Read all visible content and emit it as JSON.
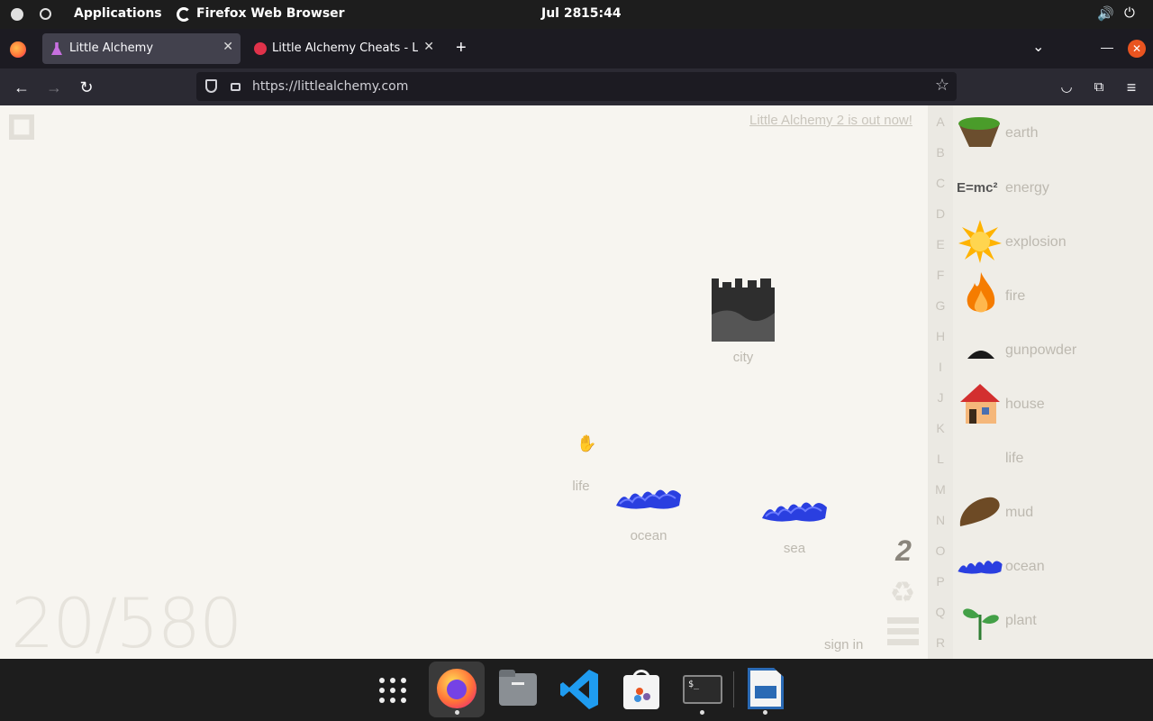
{
  "system_bar": {
    "applications": "Applications",
    "active_app": "Firefox Web Browser",
    "date": "Jul 28",
    "time": "15:44"
  },
  "tabs": [
    {
      "label": "Little Alchemy",
      "active": true
    },
    {
      "label": "Little Alchemy Cheats - List",
      "active": false
    }
  ],
  "url": "https://littlealchemy.com",
  "page": {
    "promo_link": "Little Alchemy 2 is out now!",
    "counter": "20/580",
    "sign_in": "sign in",
    "workspace_elements": [
      {
        "name": "city",
        "label": "city"
      },
      {
        "name": "life",
        "label": "life"
      },
      {
        "name": "ocean",
        "label": "ocean"
      },
      {
        "name": "sea",
        "label": "sea"
      }
    ],
    "letters": [
      "A",
      "B",
      "C",
      "D",
      "E",
      "F",
      "G",
      "H",
      "I",
      "J",
      "K",
      "L",
      "M",
      "N",
      "O",
      "P",
      "Q",
      "R"
    ],
    "sidebar_items": [
      {
        "label": "earth"
      },
      {
        "label": "energy",
        "icon_text": "E=mc²"
      },
      {
        "label": "explosion"
      },
      {
        "label": "fire"
      },
      {
        "label": "gunpowder"
      },
      {
        "label": "house"
      },
      {
        "label": "life"
      },
      {
        "label": "mud"
      },
      {
        "label": "ocean"
      },
      {
        "label": "plant"
      }
    ]
  },
  "colors": {
    "accent_firefox": "#ff7139",
    "ocean_blue": "#2a3fe0",
    "close_button": "#e95420"
  }
}
